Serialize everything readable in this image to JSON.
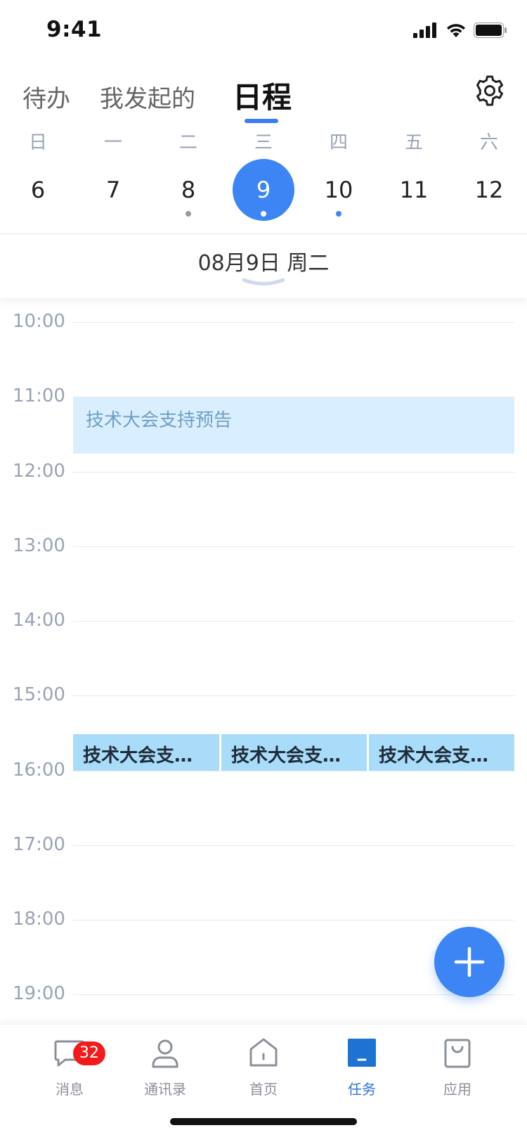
{
  "status_bar": {
    "time": "9:41"
  },
  "tabs": [
    {
      "label": "待办",
      "active": false
    },
    {
      "label": "我发起的",
      "active": false
    },
    {
      "label": "日程",
      "active": true
    }
  ],
  "week": {
    "labels": [
      "日",
      "一",
      "二",
      "三",
      "四",
      "五",
      "六"
    ],
    "days": [
      {
        "num": "6",
        "dot": null,
        "selected": false
      },
      {
        "num": "7",
        "dot": null,
        "selected": false
      },
      {
        "num": "8",
        "dot": "gray",
        "selected": false
      },
      {
        "num": "9",
        "dot": "white",
        "selected": true
      },
      {
        "num": "10",
        "dot": "blue",
        "selected": false
      },
      {
        "num": "11",
        "dot": null,
        "selected": false
      },
      {
        "num": "12",
        "dot": null,
        "selected": false
      }
    ]
  },
  "date_header": "08月9日  周二",
  "timeline": {
    "hours": [
      "10:00",
      "11:00",
      "12:00",
      "13:00",
      "14:00",
      "15:00",
      "16:00",
      "17:00",
      "18:00",
      "19:00"
    ],
    "events": [
      {
        "title": "技术大会支持预告"
      },
      {
        "title": "技术大会支持预告"
      },
      {
        "title": "技术大会支持预告"
      },
      {
        "title": "技术大会支持预告"
      }
    ]
  },
  "tabbar": {
    "items": [
      {
        "label": "消息",
        "icon": "chat-icon",
        "badge": "32",
        "active": false
      },
      {
        "label": "通讯录",
        "icon": "contacts-icon",
        "badge": "",
        "active": false
      },
      {
        "label": "首页",
        "icon": "home-icon",
        "badge": "",
        "active": false
      },
      {
        "label": "任务",
        "icon": "task-icon",
        "badge": "",
        "active": true
      },
      {
        "label": "应用",
        "icon": "apps-bag-icon",
        "badge": "",
        "active": false
      }
    ]
  },
  "colors": {
    "accent": "#3d85f5",
    "event_light": "#d9efff",
    "event_dark": "#a9dcf8",
    "badge": "#f21b1b"
  }
}
